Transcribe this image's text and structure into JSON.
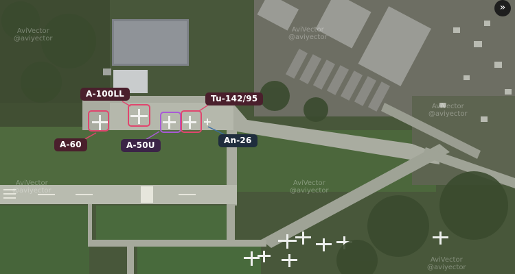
{
  "watermark": {
    "brand": "AviVector",
    "handle": "@aviyector"
  },
  "labels": {
    "a100ll": "A-100LL",
    "tu142": "Tu-142/95",
    "a60": "A-60",
    "a50u": "A-50U",
    "an26": "An-26"
  },
  "controls": {
    "expand_icon": "»"
  },
  "colors": {
    "tag_red": "#4a1f2c",
    "tag_purple": "#3b2447",
    "tag_blue": "#1f2d3d",
    "box_red": "#e0466e",
    "box_purple": "#a85ad6"
  }
}
